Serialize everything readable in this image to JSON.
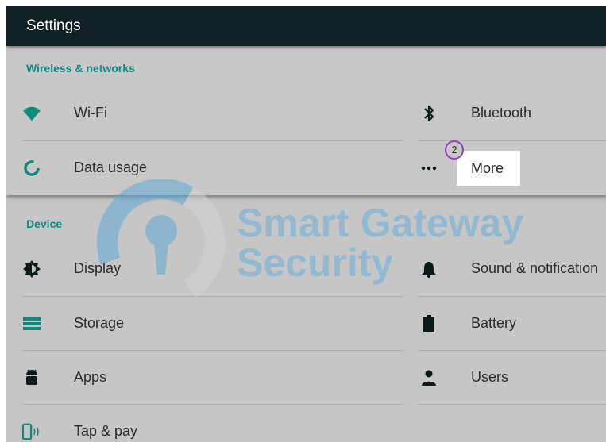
{
  "app": {
    "title": "Settings"
  },
  "sections": {
    "wireless": {
      "header": "Wireless & networks",
      "items": [
        {
          "label": "Wi-Fi",
          "icon": "wifi-icon"
        },
        {
          "label": "Bluetooth",
          "icon": "bluetooth-icon"
        },
        {
          "label": "Data usage",
          "icon": "data-usage-icon"
        },
        {
          "label": "More",
          "icon": "more-dots-icon",
          "highlighted": true
        }
      ]
    },
    "device": {
      "header": "Device",
      "items": [
        {
          "label": "Display",
          "icon": "display-brightness-icon"
        },
        {
          "label": "Sound & notification",
          "icon": "bell-icon"
        },
        {
          "label": "Storage",
          "icon": "storage-icon"
        },
        {
          "label": "Battery",
          "icon": "battery-icon"
        },
        {
          "label": "Apps",
          "icon": "android-icon"
        },
        {
          "label": "Users",
          "icon": "user-icon"
        },
        {
          "label": "Tap & pay",
          "icon": "tap-pay-icon"
        }
      ]
    }
  },
  "annotation": {
    "step": "2",
    "color": "#9b3ec2"
  },
  "watermark": {
    "line1": "Smart Gateway",
    "line2": "Security"
  },
  "colors": {
    "accent": "#0e8a7e",
    "topbar": "#0f2124"
  }
}
